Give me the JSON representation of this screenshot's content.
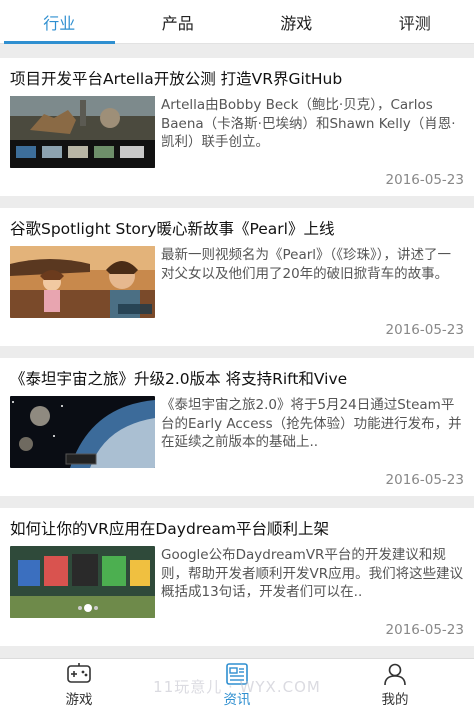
{
  "top_tabs": [
    {
      "label": "行业"
    },
    {
      "label": "产品"
    },
    {
      "label": "游戏"
    },
    {
      "label": "评测"
    }
  ],
  "accent_color": "#2f8fd0",
  "articles": [
    {
      "title": "项目开发平台Artella开放公测 打造VR界GitHub",
      "summary": "Artella由Bobby Beck（鲍比·贝克），Carlos Baena（卡洛斯·巴埃纳）和Shawn Kelly（肖恩·凯利）联手创立。",
      "date": "2016-05-23"
    },
    {
      "title": "谷歌Spotlight Story暖心新故事《Pearl》上线",
      "summary": "最新一则视频名为《Pearl》（《珍珠》），讲述了一对父女以及他们用了20年的破旧掀背车的故事。",
      "date": "2016-05-23"
    },
    {
      "title": "《泰坦宇宙之旅》升级2.0版本 将支持Rift和Vive",
      "summary": "《泰坦宇宙之旅2.0》将于5月24日通过Steam平台的Early Access（抢先体验）功能进行发布，并在延续之前版本的基础上..",
      "date": "2016-05-23"
    },
    {
      "title": "如何让你的VR应用在Daydream平台顺利上架",
      "summary": "Google公布DaydreamVR平台的开发建议和规则，帮助开发者顺利开发VR应用。我们将这些建议概括成13句话，开发者们可以在..",
      "date": "2016-05-23"
    }
  ],
  "bottom_nav": [
    {
      "label": "游戏",
      "icon": "gamepad-icon"
    },
    {
      "label": "资讯",
      "icon": "news-icon"
    },
    {
      "label": "我的",
      "icon": "user-icon"
    }
  ],
  "watermark": "11玩意儿 · WYX.COM"
}
